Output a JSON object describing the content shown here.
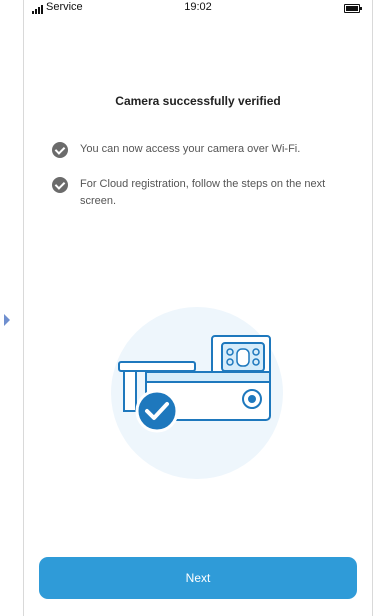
{
  "status_bar": {
    "carrier": "Service",
    "time": "19:02"
  },
  "title": "Camera successfully verified",
  "items": [
    {
      "text": "You can now access your camera over Wi-Fi."
    },
    {
      "text": "For Cloud registration, follow the steps on the next screen."
    }
  ],
  "next_button": {
    "label": "Next"
  },
  "colors": {
    "accent": "#2f9bd8",
    "check": "#6b6b6b",
    "illustration_bg": "#eef6fc",
    "dark_blue": "#1e78bd"
  }
}
